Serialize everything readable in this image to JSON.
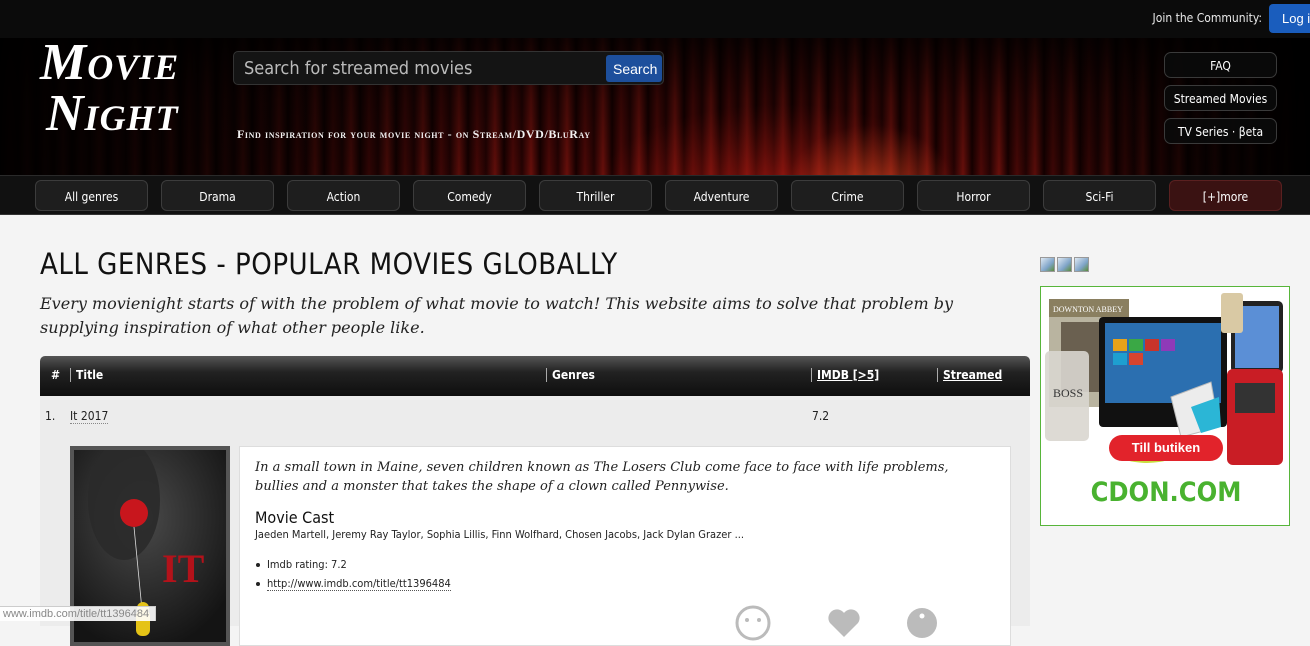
{
  "topbar": {
    "join_label": "Join the Community:",
    "login_label": "Log i"
  },
  "logo": {
    "line1": "Movie",
    "line2": "Night"
  },
  "search": {
    "placeholder": "Search for streamed movies",
    "button_label": "Search"
  },
  "tagline": "Find inspiration for your movie night - on Stream/DVD/BluRay",
  "side_links": [
    "FAQ",
    "Streamed Movies",
    "TV Series · βeta"
  ],
  "genres": [
    "All genres",
    "Drama",
    "Action",
    "Comedy",
    "Thriller",
    "Adventure",
    "Crime",
    "Horror",
    "Sci-Fi",
    "[+]more"
  ],
  "page": {
    "title": "ALL GENRES - POPULAR MOVIES GLOBALLY",
    "intro": "Every movienight starts of with the problem of what movie to watch! This website aims to solve that problem by supplying inspiration of what other people like."
  },
  "table": {
    "headers": {
      "num": "#",
      "title": "Title",
      "genres": "Genres",
      "imdb": "IMDB [>5]",
      "streamed": "Streamed"
    },
    "rows": [
      {
        "num": "1.",
        "title": "It 2017",
        "imdb": "7.2",
        "description": "In a small town in Maine, seven children known as The Losers Club come face to face with life problems, bullies and a monster that takes the shape of a clown called Pennywise.",
        "cast_heading": "Movie Cast",
        "cast": "Jaeden Martell, Jeremy Ray Taylor, Sophia Lillis, Finn Wolfhard, Chosen Jacobs, Jack Dylan Grazer ...",
        "imdb_rating_label": "Imdb rating: 7.2",
        "imdb_url": "http://www.imdb.com/title/tt1396484"
      }
    ]
  },
  "ad": {
    "button_label": "Till butiken",
    "brand": "CDON.COM",
    "product_text": "DOWNTON ABBEY"
  },
  "status_bar": "www.imdb.com/title/tt1396484",
  "colors": {
    "login_blue": "#1a5dbd",
    "search_blue": "#1d4f9c",
    "ad_green": "#49b22f",
    "ad_red": "#e2232b"
  }
}
